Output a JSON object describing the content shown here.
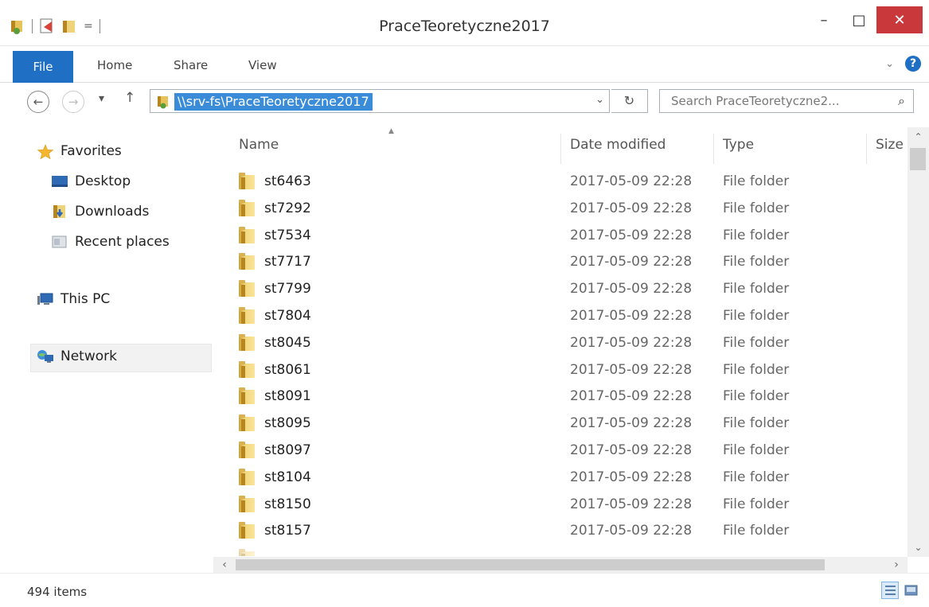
{
  "window": {
    "title": "PraceTeoretyczne2017",
    "minimize": "–",
    "maximize": "□",
    "close": "✕"
  },
  "ribbon": {
    "tabs": [
      "File",
      "Home",
      "Share",
      "View"
    ]
  },
  "navbar": {
    "back": "←",
    "forward": "→",
    "recent": "▾",
    "up": "↑",
    "address_path": "\\\\srv-fs\\PraceTeoretyczne2017",
    "address_dropdown": "⌄",
    "refresh": "↻",
    "search_placeholder": "Search PraceTeoretyczne2...",
    "search_icon": "⌕"
  },
  "sidebar": {
    "items": [
      {
        "label": "Favorites",
        "icon": "star-icon"
      },
      {
        "label": "Desktop",
        "icon": "desktop-icon"
      },
      {
        "label": "Downloads",
        "icon": "downloads-icon"
      },
      {
        "label": "Recent places",
        "icon": "recent-places-icon"
      },
      {
        "label": "This PC",
        "icon": "computer-icon"
      },
      {
        "label": "Network",
        "icon": "network-icon"
      }
    ]
  },
  "columns": {
    "name": "Name",
    "date": "Date modified",
    "type": "Type",
    "size": "Size"
  },
  "files": [
    {
      "name": "st6463",
      "date": "2017-05-09 22:28",
      "type": "File folder"
    },
    {
      "name": "st7292",
      "date": "2017-05-09 22:28",
      "type": "File folder"
    },
    {
      "name": "st7534",
      "date": "2017-05-09 22:28",
      "type": "File folder"
    },
    {
      "name": "st7717",
      "date": "2017-05-09 22:28",
      "type": "File folder"
    },
    {
      "name": "st7799",
      "date": "2017-05-09 22:28",
      "type": "File folder"
    },
    {
      "name": "st7804",
      "date": "2017-05-09 22:28",
      "type": "File folder"
    },
    {
      "name": "st8045",
      "date": "2017-05-09 22:28",
      "type": "File folder"
    },
    {
      "name": "st8061",
      "date": "2017-05-09 22:28",
      "type": "File folder"
    },
    {
      "name": "st8091",
      "date": "2017-05-09 22:28",
      "type": "File folder"
    },
    {
      "name": "st8095",
      "date": "2017-05-09 22:28",
      "type": "File folder"
    },
    {
      "name": "st8097",
      "date": "2017-05-09 22:28",
      "type": "File folder"
    },
    {
      "name": "st8104",
      "date": "2017-05-09 22:28",
      "type": "File folder"
    },
    {
      "name": "st8150",
      "date": "2017-05-09 22:28",
      "type": "File folder"
    },
    {
      "name": "st8157",
      "date": "2017-05-09 22:28",
      "type": "File folder"
    }
  ],
  "status": {
    "item_count": "494 items"
  },
  "colors": {
    "accent": "#1f6fc5",
    "close_button": "#c9393b",
    "selection": "#3a8cd8"
  }
}
